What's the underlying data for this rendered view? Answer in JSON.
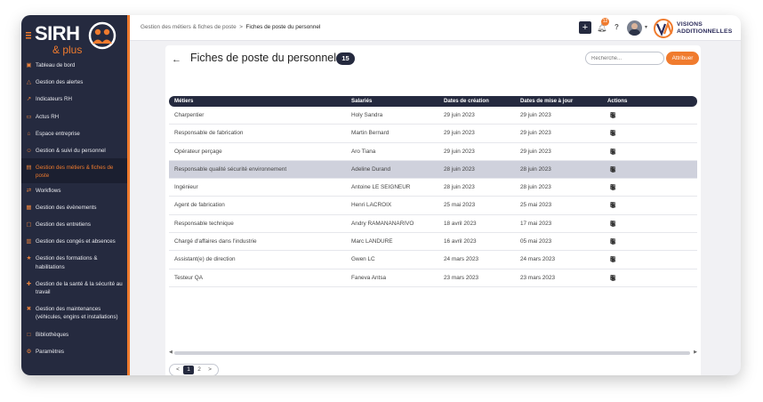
{
  "logo": {
    "brand": "SIRH",
    "suffix": "& plus",
    "accent": "#f07b2e",
    "dark": "#252a3f"
  },
  "sidebar": {
    "items": [
      {
        "icon": "dashboard-icon",
        "label": "Tableau de bord"
      },
      {
        "icon": "bell-icon",
        "label": "Gestion des alertes"
      },
      {
        "icon": "chart-icon",
        "label": "Indicateurs RH"
      },
      {
        "icon": "news-icon",
        "label": "Actus RH"
      },
      {
        "icon": "building-icon",
        "label": "Espace entreprise"
      },
      {
        "icon": "people-icon",
        "label": "Gestion & suivi du personnel"
      },
      {
        "icon": "briefcase-icon",
        "label": "Gestion des métiers & fiches de poste",
        "active": true
      },
      {
        "icon": "workflow-icon",
        "label": "Workflows"
      },
      {
        "icon": "calendar-icon",
        "label": "Gestion des évènements"
      },
      {
        "icon": "interview-icon",
        "label": "Gestion des entretiens"
      },
      {
        "icon": "leave-icon",
        "label": "Gestion des congés et absences"
      },
      {
        "icon": "training-icon",
        "label": "Gestion des formations & habilitations"
      },
      {
        "icon": "health-icon",
        "label": "Gestion de la santé & la sécurité au travail"
      },
      {
        "icon": "tools-icon",
        "label": "Gestion des maintenances (véhicules, engins et installations)"
      },
      {
        "icon": "library-icon",
        "label": "Bibliothèques"
      },
      {
        "icon": "settings-icon",
        "label": "Paramètres"
      }
    ]
  },
  "topbar": {
    "breadcrumb_parent": "Gestion des métiers & fiches de poste",
    "breadcrumb_sep": ">",
    "breadcrumb_current": "Fiches de poste du personnel",
    "notif_count": "12",
    "help": "?",
    "brand_line1": "VISIONS",
    "brand_line2": "ADDITIONNELLES"
  },
  "page": {
    "title": "Fiches de poste du personnel",
    "count": "15",
    "search_placeholder": "Recherche...",
    "assign_label": "Attribuer"
  },
  "table": {
    "headers": [
      "Métiers",
      "Salariés",
      "Dates de création",
      "Dates de mise à jour",
      "Actions"
    ],
    "rows": [
      [
        "Charpentier",
        "Holy Sandra",
        "29 juin 2023",
        "29 juin 2023"
      ],
      [
        "Responsable de fabrication",
        "Martin Bernard",
        "29 juin 2023",
        "29 juin 2023"
      ],
      [
        "Opérateur perçage",
        "Aro Tiana",
        "29 juin 2023",
        "29 juin 2023"
      ],
      [
        "Responsable qualité sécurité environnement",
        "Adeline Durand",
        "28 juin 2023",
        "28 juin 2023"
      ],
      [
        "Ingénieur",
        "Antoine LE SEIGNEUR",
        "28 juin 2023",
        "28 juin 2023"
      ],
      [
        "Agent de fabrication",
        "Henri LACROIX",
        "25 mai 2023",
        "25 mai 2023"
      ],
      [
        "Responsable technique",
        "Andry RAMANANARIVO",
        "18 avril 2023",
        "17 mai 2023"
      ],
      [
        "Chargé d'affaires dans l'industrie",
        "Marc LANDURE",
        "16 avril 2023",
        "05 mai 2023"
      ],
      [
        "Assistant(e) de direction",
        "Gwen LC",
        "24 mars 2023",
        "24 mars 2023"
      ],
      [
        "Testeur QA",
        "Faneva Antsa",
        "23 mars 2023",
        "23 mars 2023"
      ]
    ],
    "highlighted_row": 3
  },
  "pagination": {
    "prev": "<",
    "pages": [
      "1",
      "2"
    ],
    "current": "1",
    "next": ">"
  }
}
